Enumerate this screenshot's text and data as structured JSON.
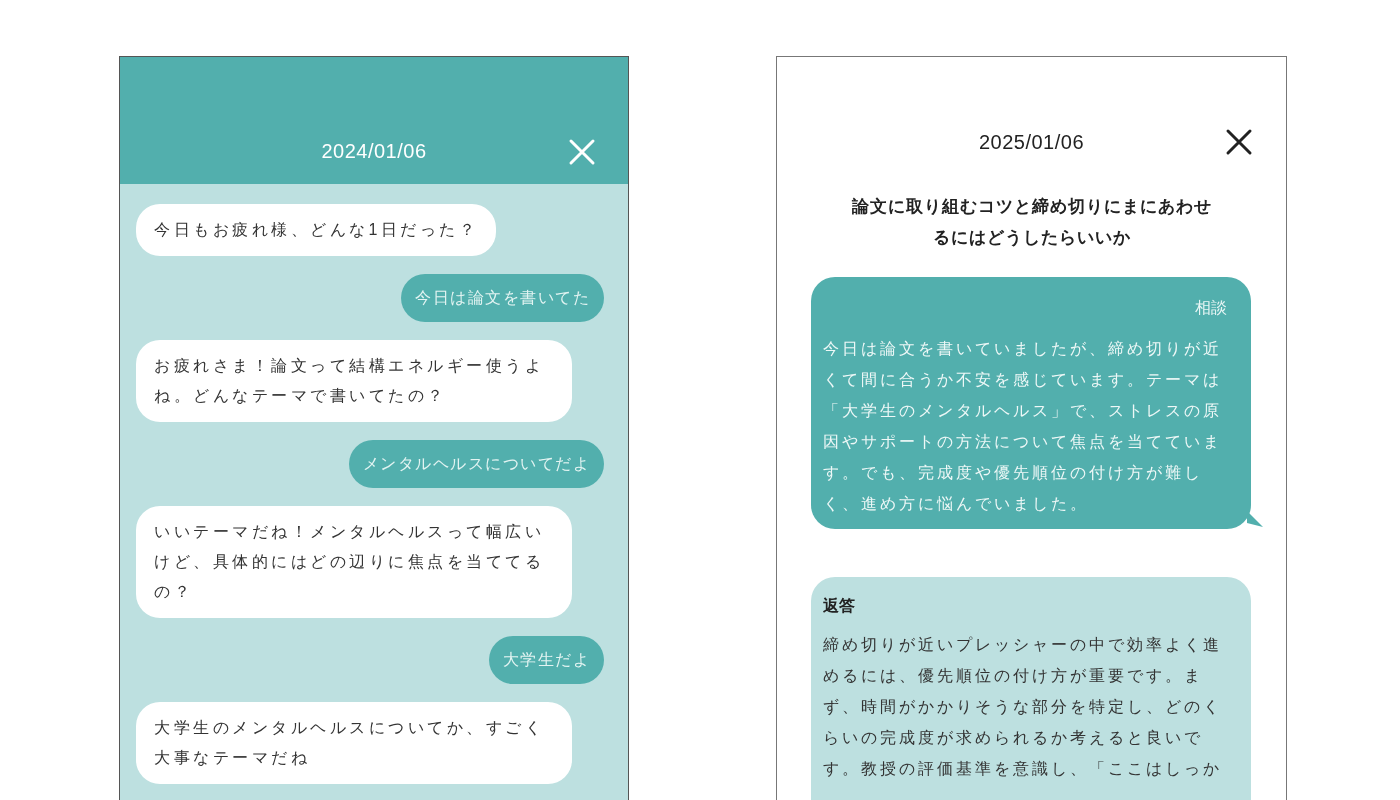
{
  "chat_panel": {
    "date": "2024/01/06",
    "messages": [
      {
        "kind": "bot",
        "text": "今日もお疲れ様、どんな1日だった？"
      },
      {
        "kind": "user",
        "text": "今日は論文を書いてた"
      },
      {
        "kind": "bot",
        "text": "お疲れさま！論文って結構エネルギー使うよね。どんなテーマで書いてたの？"
      },
      {
        "kind": "user",
        "text": "メンタルヘルスについてだよ"
      },
      {
        "kind": "bot",
        "text": "いいテーマだね！メンタルヘルスって幅広いけど、具体的にはどの辺りに焦点を当ててるの？"
      },
      {
        "kind": "user",
        "text": "大学生だよ"
      },
      {
        "kind": "bot",
        "text": "大学生のメンタルヘルスについてか、すごく大事なテーマだね"
      }
    ]
  },
  "summary_panel": {
    "date": "2025/01/06",
    "title": "論文に取り組むコツと締め切りにまにあわせるにはどうしたらいいか",
    "cards": [
      {
        "kind": "consult",
        "label": "相談",
        "text": "今日は論文を書いていましたが、締め切りが近くて間に合うか不安を感じています。テーマは「大学生のメンタルヘルス」で、ストレスの原因やサポートの方法について焦点を当てています。でも、完成度や優先順位の付け方が難しく、進め方に悩んでいました。"
      },
      {
        "kind": "reply",
        "label": "返答",
        "text": "締め切りが近いプレッシャーの中で効率よく進めるには、優先順位の付け方が重要です。まず、時間がかかりそうな部分を特定し、どのくらいの完成度が求められるか考えると良いです。教授の評価基準を意識し、「ここはしっか"
      }
    ]
  }
}
